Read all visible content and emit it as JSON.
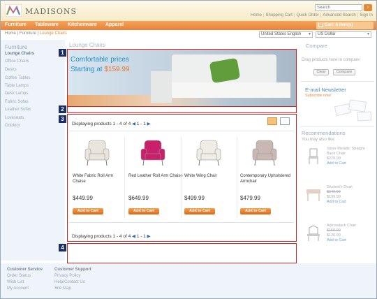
{
  "header": {
    "logo_text": "MADISONS",
    "search_placeholder": "Search",
    "search_button_glyph": "›",
    "toplinks": [
      "Home",
      "Shopping Cart",
      "Quick Order",
      "Advanced Search",
      "Sign In"
    ]
  },
  "nav": {
    "items": [
      "Furniture",
      "Tableware",
      "Kitchenware",
      "Apparel"
    ],
    "cart_label": "Cart: 0 item(s)"
  },
  "breadcrumb": {
    "items": [
      "Home",
      "Furniture"
    ],
    "current": "Lounge Chairs",
    "separator": "|"
  },
  "locale": {
    "language": "United States English",
    "currency": "US Dollar"
  },
  "sidebar": {
    "title": "Furniture",
    "items": [
      "Lounge Chairs",
      "Office Chairs",
      "Desks",
      "Coffee Tables",
      "Table Lamps",
      "Desk Lamps",
      "Fabric Sofas",
      "Leather Sofas",
      "Loveseats",
      "Outdoor"
    ],
    "active_index": 0
  },
  "main": {
    "page_title": "Lounge Chairs",
    "banner": {
      "line1": "Comfortable prices",
      "line2_prefix": "Starting at ",
      "line2_price": "$159.99"
    },
    "callouts": [
      "1",
      "2",
      "3",
      "4"
    ],
    "pager": {
      "text": "Displaying products 1 - 4 of 4",
      "prev": "◀",
      "pages": "1 - 1",
      "next": "▶"
    },
    "products": [
      {
        "name": "White Fabric Roll Arm Chaise",
        "price": "$449.99",
        "button": "Add to Cart",
        "image_color": "#e9e4dc"
      },
      {
        "name": "Red Leather Roll Arm Chaise",
        "price": "$649.99",
        "button": "Add to Cart",
        "image_color": "#c8206a"
      },
      {
        "name": "White Wing Chair",
        "price": "$499.99",
        "button": "Add to Cart",
        "image_color": "#f0ece6"
      },
      {
        "name": "Contemporary Upholstered Armchair",
        "price": "$479.99",
        "button": "Add to Cart",
        "image_color": "#c9b8b2"
      }
    ]
  },
  "right": {
    "compare_title": "Compare",
    "compare_text": "Drag products here to compare",
    "clear_button": "Clear",
    "compare_button": "Compare",
    "newsletter_title": "E-mail Newsletter",
    "newsletter_sub": "Subscribe now!",
    "recommendations_title": "Recommendations",
    "recommendations_sub": "You may also like:",
    "recs": [
      {
        "name": "Silver Metallic Straight Back Chair",
        "price": "$229.99",
        "link": "Add to Cart"
      },
      {
        "name": "Student's Desk",
        "old_price": "$249.99",
        "price": "$199.99",
        "link": "Add to Cart"
      },
      {
        "name": "Adirondack Chair",
        "old_price": "$159.99",
        "price": "$126.99",
        "link": "Add to Cart"
      }
    ]
  },
  "footer": {
    "col1_title": "Customer Service",
    "col1_items": [
      "Order Status",
      "Wish List",
      "My Account"
    ],
    "col2_title": "Customer Support",
    "col2_items": [
      "Privacy Policy",
      "Help/Contact Us",
      "Site Map"
    ]
  },
  "colors": {
    "accent_orange": "#e8823a",
    "callout_navy": "#1a2f66",
    "outline_red": "#cc2222",
    "link_blue": "#2a8ec8"
  }
}
